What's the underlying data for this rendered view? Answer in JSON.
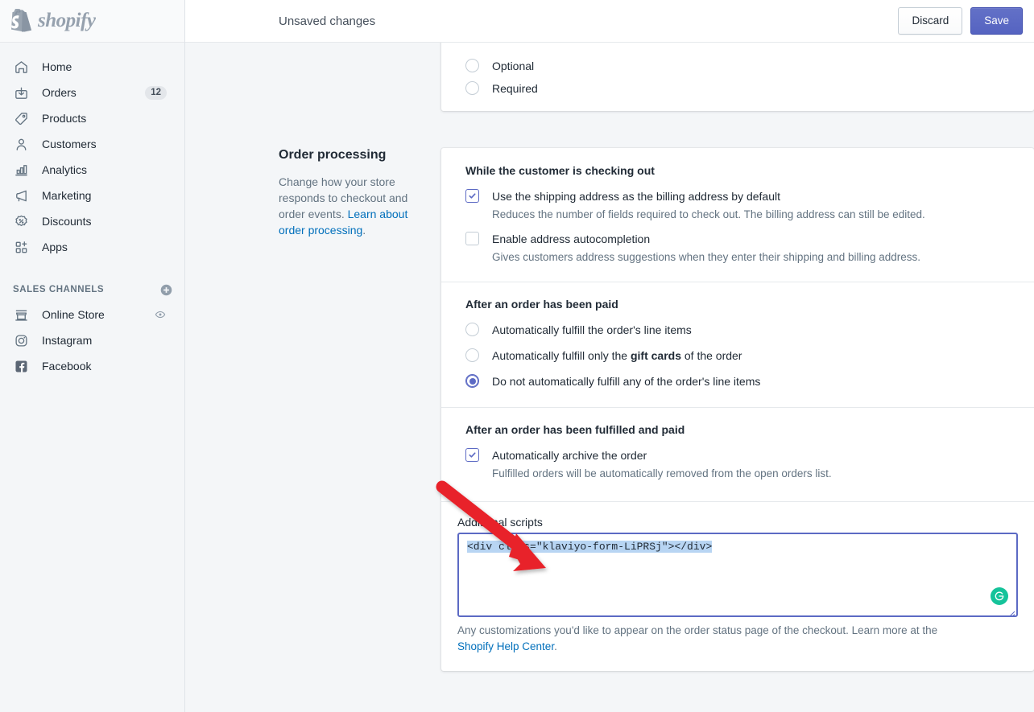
{
  "brand": {
    "name": "shopify",
    "logo_icon": "shopify-bag-icon",
    "accent": "#5c6ac4",
    "link_color": "#006fbb"
  },
  "sidebar": {
    "items": [
      {
        "label": "Home",
        "icon": "home-icon"
      },
      {
        "label": "Orders",
        "icon": "orders-icon",
        "badge": "12"
      },
      {
        "label": "Products",
        "icon": "products-tag-icon"
      },
      {
        "label": "Customers",
        "icon": "customers-person-icon"
      },
      {
        "label": "Analytics",
        "icon": "analytics-bar-chart-icon"
      },
      {
        "label": "Marketing",
        "icon": "marketing-megaphone-icon"
      },
      {
        "label": "Discounts",
        "icon": "discounts-percent-icon"
      },
      {
        "label": "Apps",
        "icon": "apps-grid-plus-icon"
      }
    ],
    "sales_channels": {
      "title": "SALES CHANNELS",
      "add_icon": "plus-circle-icon",
      "items": [
        {
          "label": "Online Store",
          "icon": "online-store-icon",
          "trailing_icon": "eye-icon"
        },
        {
          "label": "Instagram",
          "icon": "instagram-icon"
        },
        {
          "label": "Facebook",
          "icon": "facebook-icon"
        }
      ]
    }
  },
  "topbar": {
    "title": "Unsaved changes",
    "discard_label": "Discard",
    "save_label": "Save"
  },
  "partial_card": {
    "options": [
      {
        "label": "Optional",
        "checked": false
      },
      {
        "label": "Required",
        "checked": false
      }
    ]
  },
  "order_processing": {
    "heading": "Order processing",
    "description_before": "Change how your store responds to checkout and order events. ",
    "description_link": "Learn about order processing",
    "description_after": "."
  },
  "checking_out": {
    "title": "While the customer is checking out",
    "options": [
      {
        "label": "Use the shipping address as the billing address by default",
        "help": "Reduces the number of fields required to check out. The billing address can still be edited.",
        "checked": true
      },
      {
        "label": "Enable address autocompletion",
        "help": "Gives customers address suggestions when they enter their shipping and billing address.",
        "checked": false
      }
    ]
  },
  "after_paid": {
    "title": "After an order has been paid",
    "options": [
      {
        "label": "Automatically fulfill the order's line items",
        "selected": false
      },
      {
        "label_pre": "Automatically fulfill only the ",
        "label_strong": "gift cards",
        "label_post": " of the order",
        "selected": false
      },
      {
        "label": "Do not automatically fulfill any of the order's line items",
        "selected": true
      }
    ]
  },
  "after_fulfilled": {
    "title": "After an order has been fulfilled and paid",
    "options": [
      {
        "label": "Automatically archive the order",
        "help": "Fulfilled orders will be automatically removed from the open orders list.",
        "checked": true
      }
    ]
  },
  "additional_scripts": {
    "label": "Additional scripts",
    "value": "<div class=\"klaviyo-form-LiPRSj\"></div>",
    "grammarly_icon": "grammarly-icon",
    "resize_icon": "resize-grip-icon",
    "help_before": "Any customizations you'd like to appear on the order status page of the checkout. Learn more at the ",
    "help_link": "Shopify Help Center",
    "help_after": "."
  },
  "annotation": {
    "arrow_icon": "red-arrow-icon",
    "arrow_color": "#e8242a"
  }
}
